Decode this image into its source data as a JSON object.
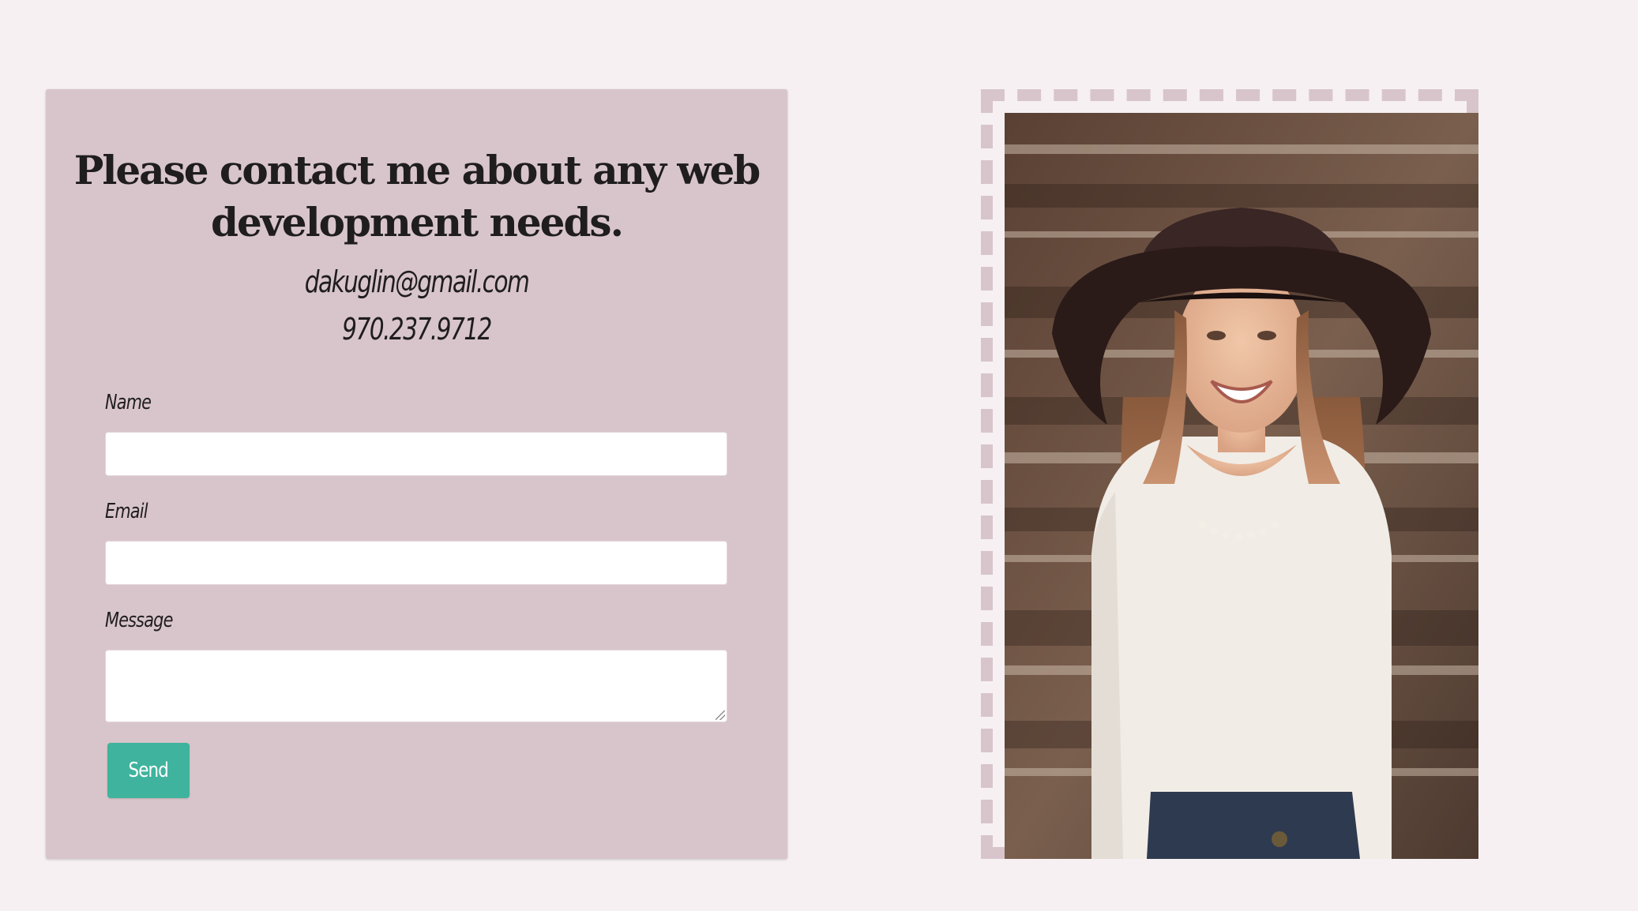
{
  "contact": {
    "heading": "Please contact me about any web development needs.",
    "email": "dakuglin@gmail.com",
    "phone": "970.237.9712"
  },
  "form": {
    "name_label": "Name",
    "name_value": "",
    "email_label": "Email",
    "email_value": "",
    "message_label": "Message",
    "message_value": "",
    "send_label": "Send"
  },
  "colors": {
    "background": "#f6f0f2",
    "card": "#d8c5cb",
    "button": "#3fb39d",
    "text": "#1f1d1e"
  }
}
